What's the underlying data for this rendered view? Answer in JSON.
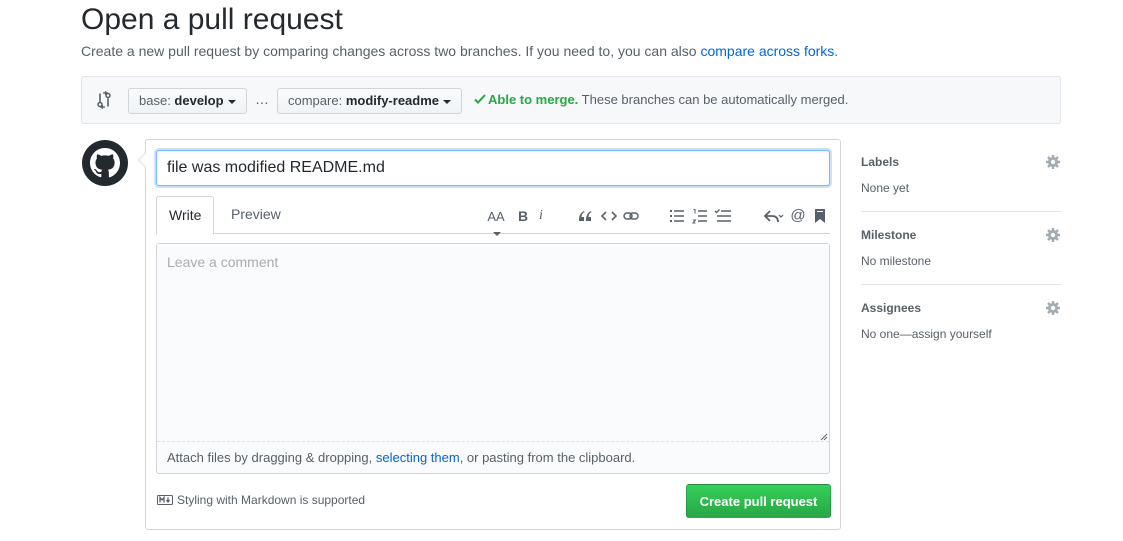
{
  "page": {
    "title": "Open a pull request",
    "subtitle_text": "Create a new pull request by comparing changes across two branches. If you need to, you can also ",
    "subtitle_link": "compare across forks",
    "subtitle_end": "."
  },
  "range": {
    "base_prefix": "base: ",
    "base_branch": "develop",
    "separator": "…",
    "compare_prefix": "compare: ",
    "compare_branch": "modify-readme",
    "merge_ok": "Able to merge.",
    "merge_detail": " These branches can be automatically merged."
  },
  "form": {
    "title_value": "file was modified README.md",
    "tabs": [
      {
        "label": "Write"
      },
      {
        "label": "Preview"
      }
    ],
    "comment_placeholder": "Leave a comment",
    "attach_prefix": "Attach files by dragging & dropping, ",
    "attach_link": "selecting them",
    "attach_suffix": ", or pasting from the clipboard.",
    "markdown_note": "Styling with Markdown is supported",
    "submit_label": "Create pull request"
  },
  "toolbar": {
    "icons": [
      "header-icon",
      "bold-icon",
      "italic-icon",
      "quote-icon",
      "code-icon",
      "link-icon",
      "unordered-list-icon",
      "ordered-list-icon",
      "task-list-icon",
      "reply-icon",
      "mention-icon",
      "bookmark-icon"
    ],
    "header_glyph": "AA",
    "bold_glyph": "B",
    "italic_glyph": "i",
    "mention_glyph": "@"
  },
  "sidebar": {
    "sections": [
      {
        "heading": "Labels",
        "value": "None yet"
      },
      {
        "heading": "Milestone",
        "value": "No milestone"
      },
      {
        "heading": "Assignees",
        "value": "No one—assign yourself"
      }
    ]
  },
  "colors": {
    "link": "#0366d6",
    "success": "#28a745",
    "focus_border": "#79b8ff",
    "muted": "#586069"
  }
}
